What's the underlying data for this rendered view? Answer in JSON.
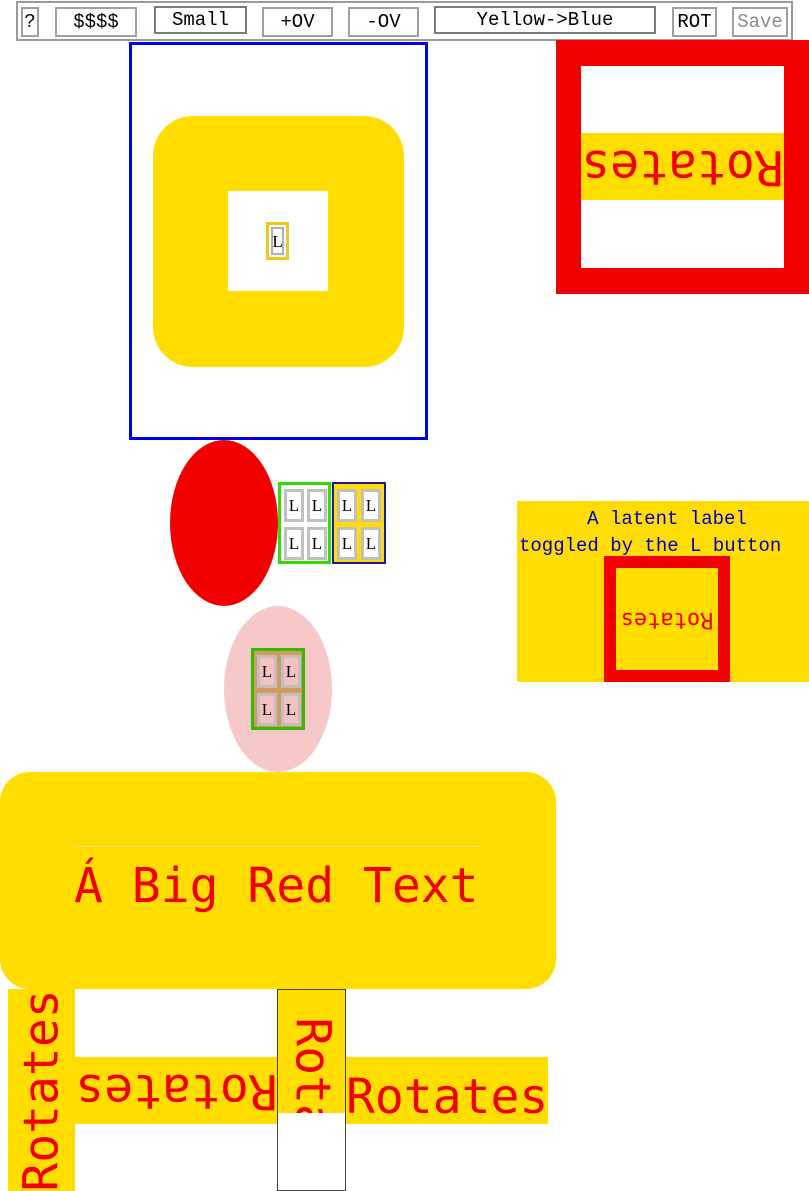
{
  "toolbar": {
    "help": "?",
    "money": "$$$$",
    "small": "Small",
    "plus_ov": "+OV",
    "minus_ov": "-OV",
    "yellow_blue": "Yellow->Blue",
    "rot": "ROT",
    "save": "Save"
  },
  "cells": {
    "l": "L"
  },
  "latent_label": {
    "line1": "A latent label",
    "line2": "toggled by the L button"
  },
  "rotates_text": "Rotates",
  "big_text": "Á Big Red Text",
  "colors": {
    "yellow": "#ffdd00",
    "red": "#f00000",
    "blue": "#0000ee",
    "green": "#33dd00",
    "pink": "#f6c8c8",
    "label_blue": "#0000cc"
  }
}
